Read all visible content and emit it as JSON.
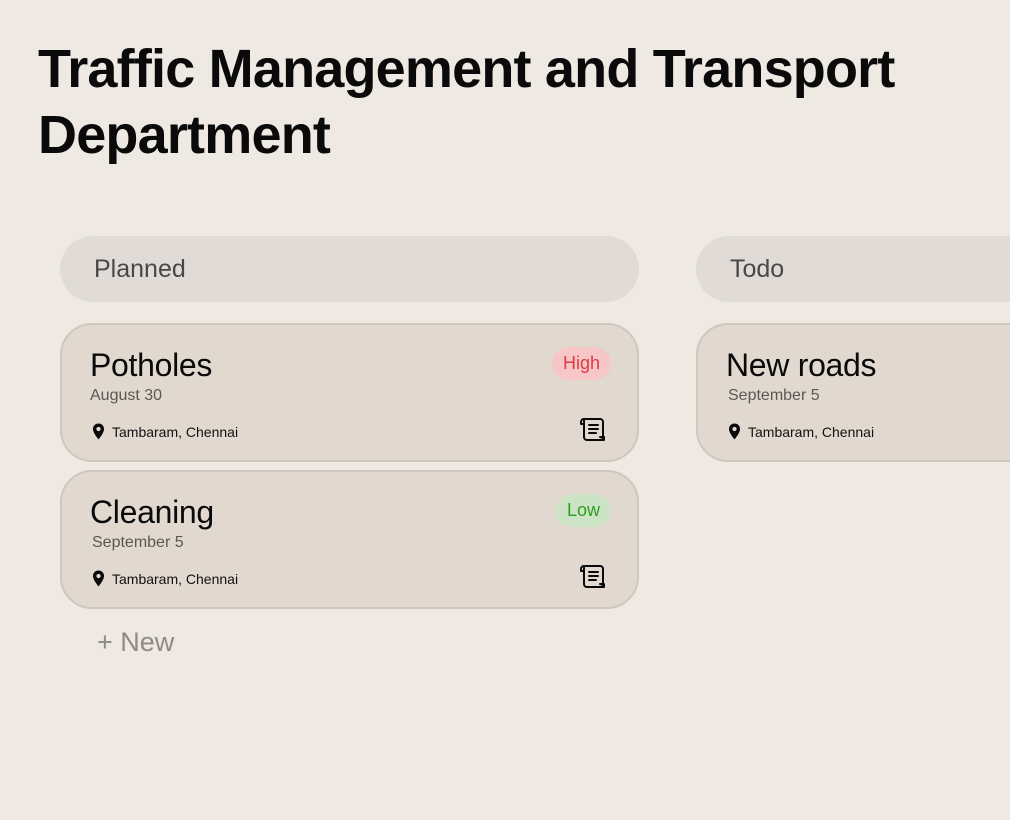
{
  "title": "Traffic Management and Transport Department",
  "columns": [
    {
      "name": "Planned",
      "cards": [
        {
          "title": "Potholes",
          "date": "August 30",
          "location": "Tambaram, Chennai",
          "priority": "High"
        },
        {
          "title": "Cleaning",
          "date": "September 5",
          "location": "Tambaram, Chennai",
          "priority": "Low"
        }
      ],
      "new_label": "+ New"
    },
    {
      "name": "Todo",
      "cards": [
        {
          "title": "New roads",
          "date": "September 5",
          "location": "Tambaram, Chennai"
        }
      ]
    }
  ],
  "icons": {
    "location": "map-pin-icon",
    "details": "scroll-icon"
  },
  "colors": {
    "high_badge_bg": "#f7c6c7",
    "high_badge_text": "#df3c46",
    "low_badge_bg": "#cde3c6",
    "low_badge_text": "#2f9e21"
  }
}
